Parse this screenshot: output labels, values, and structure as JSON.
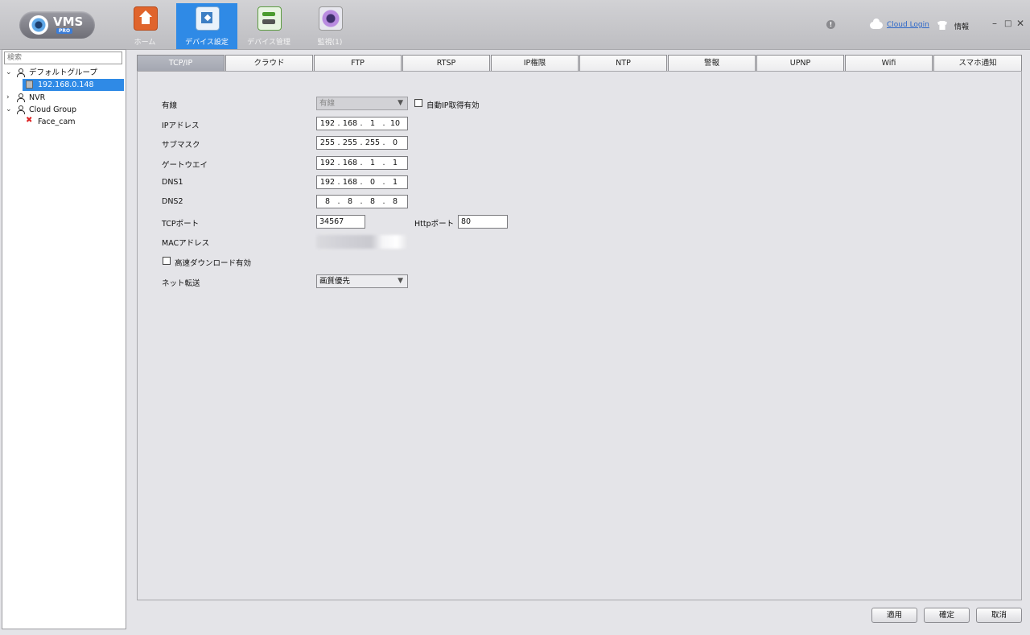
{
  "app": {
    "logo_text": "VMS",
    "logo_badge": "PRO"
  },
  "nav": [
    {
      "label": "ホーム",
      "icon": "home-icon"
    },
    {
      "label": "デバイス設定",
      "icon": "device-config-icon"
    },
    {
      "label": "デバイス管理",
      "icon": "device-manager-icon"
    },
    {
      "label": "監視(1)",
      "icon": "monitor-icon"
    }
  ],
  "header": {
    "cloud_login": "Cloud Login",
    "info": "情報",
    "alert_symbol": "!",
    "window_controls": {
      "minimize": "–",
      "maximize": "□",
      "close": "✕"
    }
  },
  "sidebar": {
    "search_placeholder": "検索",
    "tree": [
      {
        "label": "デフォルトグループ",
        "expanded": true
      },
      {
        "label": "192.168.0.148",
        "selected": true
      },
      {
        "label": "NVR",
        "expanded": false
      },
      {
        "label": "Cloud Group",
        "expanded": true
      },
      {
        "label": "Face_cam",
        "status": "error"
      }
    ]
  },
  "tabs": [
    "TCP/IP",
    "クラウド",
    "FTP",
    "RTSP",
    "IP権限",
    "NTP",
    "警報",
    "UPNP",
    "Wifi",
    "スマホ通知"
  ],
  "active_tab": "TCP/IP",
  "form": {
    "wired_label": "有線",
    "wired_value": "有線",
    "dhcp_label": "自動IP取得有効",
    "ip_label": "IPアドレス",
    "ip": [
      "192",
      "168",
      "1",
      "10"
    ],
    "subnet_label": "サブマスク",
    "subnet": [
      "255",
      "255",
      "255",
      "0"
    ],
    "gateway_label": "ゲートウエイ",
    "gateway": [
      "192",
      "168",
      "1",
      "1"
    ],
    "dns1_label": "DNS1",
    "dns1": [
      "192",
      "168",
      "0",
      "1"
    ],
    "dns2_label": "DNS2",
    "dns2": [
      "8",
      "8",
      "8",
      "8"
    ],
    "tcp_port_label": "TCPポート",
    "tcp_port": "34567",
    "http_port_label": "Httpポート",
    "http_port": "80",
    "mac_label": "MACアドレス",
    "fast_download_label": "高速ダウンロード有効",
    "net_transfer_label": "ネット転送",
    "net_transfer_value": "画質優先",
    "dropdown_arrow": "▼"
  },
  "buttons": {
    "apply": "適用",
    "ok": "確定",
    "cancel": "取消"
  }
}
